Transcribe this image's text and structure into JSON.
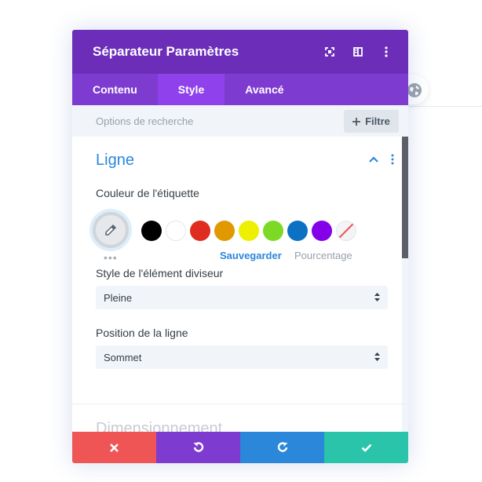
{
  "header": {
    "title": "Séparateur Paramètres",
    "icons": [
      "expand-icon",
      "sidebar-layout-icon",
      "more-vertical-icon"
    ]
  },
  "tabs": [
    {
      "label": "Contenu",
      "active": false
    },
    {
      "label": "Style",
      "active": true
    },
    {
      "label": "Avancé",
      "active": false
    }
  ],
  "search": {
    "placeholder": "Options de recherche",
    "filter_label": "Filtre"
  },
  "section": {
    "title": "Ligne",
    "color_label": "Couleur de l'étiquette",
    "swatches": [
      {
        "name": "black",
        "color": "#000000"
      },
      {
        "name": "white",
        "color": "#ffffff"
      },
      {
        "name": "red",
        "color": "#e02b20"
      },
      {
        "name": "orange",
        "color": "#e09900"
      },
      {
        "name": "yellow",
        "color": "#edf000"
      },
      {
        "name": "green",
        "color": "#7cda24"
      },
      {
        "name": "blue",
        "color": "#0c71c3"
      },
      {
        "name": "purple",
        "color": "#8300e9"
      },
      {
        "name": "none",
        "color": "transparent"
      }
    ],
    "save_label": "Sauvegarder",
    "percent_label": "Pourcentage",
    "divider_style_label": "Style de l'élément diviseur",
    "divider_style_value": "Pleine",
    "position_label": "Position de la ligne",
    "position_value": "Sommet"
  },
  "section2": {
    "title": "Dimensionnement"
  },
  "footer": {
    "buttons": [
      {
        "name": "cancel",
        "color": "#ef5555"
      },
      {
        "name": "undo",
        "color": "#7e3bd0"
      },
      {
        "name": "redo",
        "color": "#2b87da"
      },
      {
        "name": "confirm",
        "color": "#29c4a9"
      }
    ]
  },
  "colors": {
    "header_bg": "#6c2eb9",
    "tabs_bg": "#7e3bd0",
    "active_tab": "#8f42ec",
    "accent_blue": "#2b87da"
  }
}
